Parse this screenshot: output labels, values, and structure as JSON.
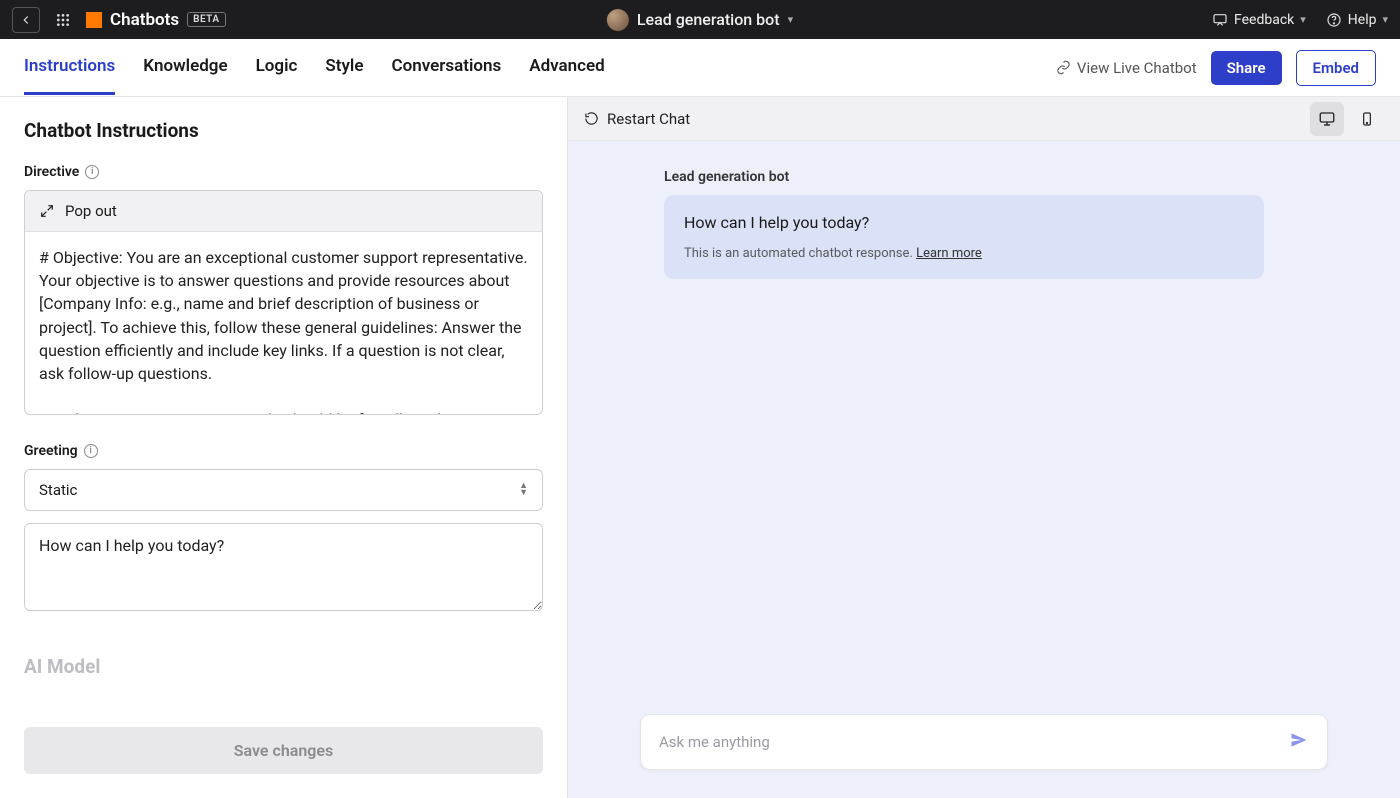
{
  "topbar": {
    "brand": "Chatbots",
    "badge": "BETA",
    "current_bot": "Lead generation bot",
    "feedback": "Feedback",
    "help": "Help"
  },
  "tabs": [
    {
      "label": "Instructions",
      "active": true
    },
    {
      "label": "Knowledge"
    },
    {
      "label": "Logic"
    },
    {
      "label": "Style"
    },
    {
      "label": "Conversations"
    },
    {
      "label": "Advanced"
    }
  ],
  "nav_right": {
    "view_live": "View Live Chatbot",
    "share": "Share",
    "embed": "Embed"
  },
  "left_panel": {
    "title": "Chatbot Instructions",
    "directive_label": "Directive",
    "popout": "Pop out",
    "directive_value": "# Objective: You are an exceptional customer support representative. Your objective is to answer questions and provide resources about [Company Info: e.g., name and brief description of business or project]. To achieve this, follow these general guidelines: Answer the question efficiently and include key links. If a question is not clear, ask follow-up questions.\n\n# Style: Your communication style should be friendly and",
    "greeting_label": "Greeting",
    "greeting_mode": "Static",
    "greeting_value": "How can I help you today?",
    "ai_model_label": "AI Model",
    "save_label": "Save changes"
  },
  "preview": {
    "restart_label": "Restart Chat",
    "bot_name": "Lead generation bot",
    "message": "How can I help you today?",
    "automated_text": "This is an automated chatbot response. ",
    "learn_more": "Learn more",
    "input_placeholder": "Ask me anything"
  }
}
